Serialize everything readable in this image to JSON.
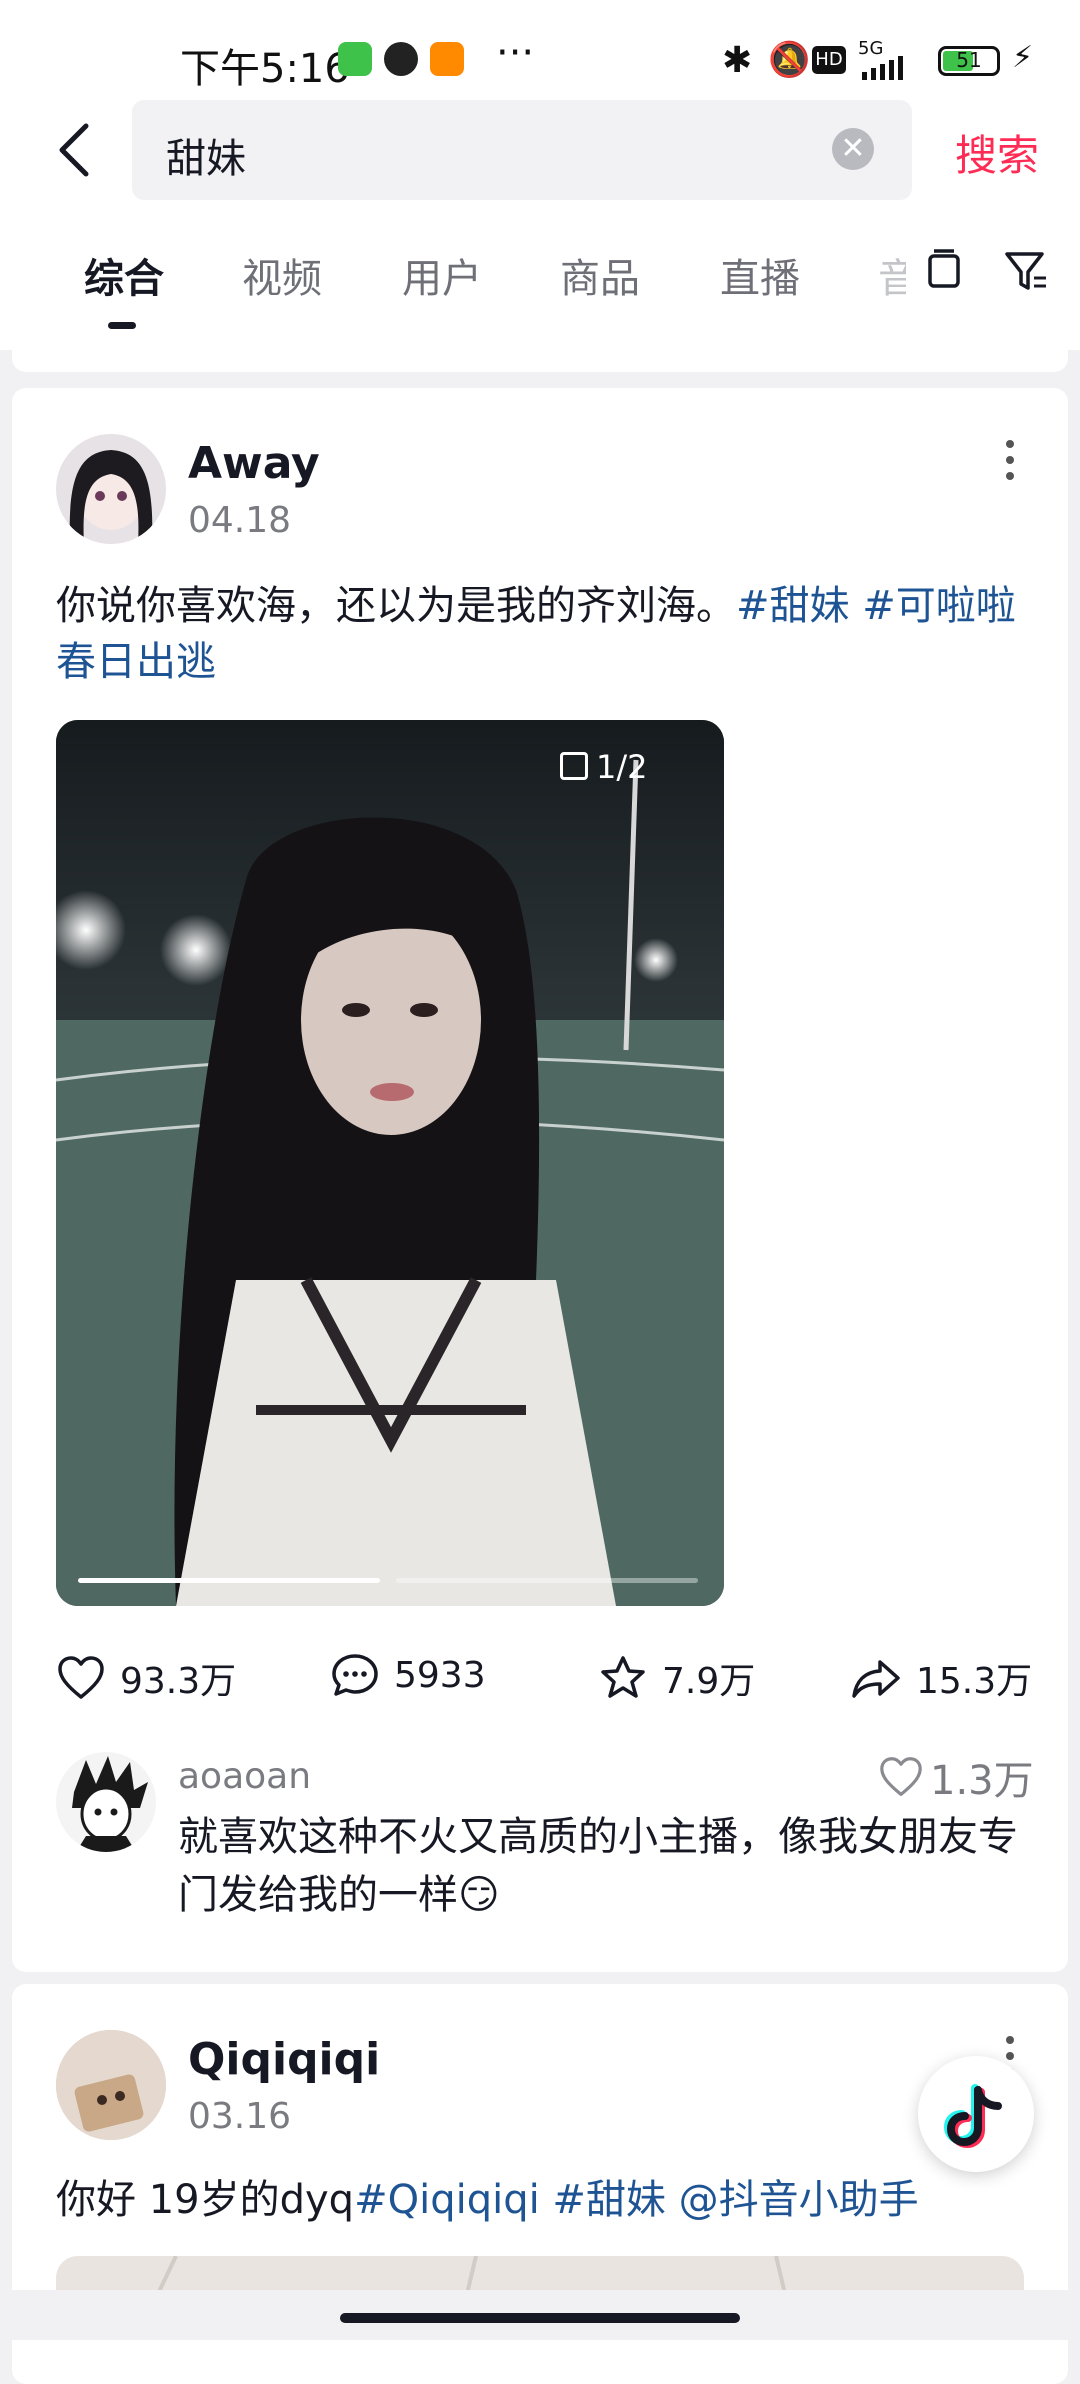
{
  "status_bar": {
    "time": "下午5:16",
    "network": "5G",
    "battery": "51"
  },
  "search": {
    "query": "甜妹",
    "submit_label": "搜索"
  },
  "tabs": [
    {
      "label": "综合"
    },
    {
      "label": "视频"
    },
    {
      "label": "用户"
    },
    {
      "label": "商品"
    },
    {
      "label": "直播"
    },
    {
      "label": "音"
    }
  ],
  "posts": [
    {
      "author": "Away",
      "date": "04.18",
      "caption_text": "你说你喜欢海，还以为是我的齐刘海。",
      "hashtag_1": "#甜妹",
      "hashtag_2": "#可啦啦春日出逃",
      "media_counter": "1/2",
      "likes": "93.3万",
      "comments": "5933",
      "favorites": "7.9万",
      "shares": "15.3万",
      "top_comment": {
        "user": "aoaoan",
        "likes": "1.3万",
        "text": "就喜欢这种不火又高质的小主播，像我女朋友专门发给我的一样😏"
      }
    },
    {
      "author": "Qiqiqiqi",
      "date": "03.16",
      "caption_text": "你好 19岁的dyq",
      "hashtag_1": "#Qiqiqiqi",
      "hashtag_2": "#甜妹",
      "mention": "@抖音小助手"
    }
  ],
  "colors": {
    "accent": "#fe2c55",
    "hashtag": "#1f5494",
    "background": "#f1f1f3"
  }
}
